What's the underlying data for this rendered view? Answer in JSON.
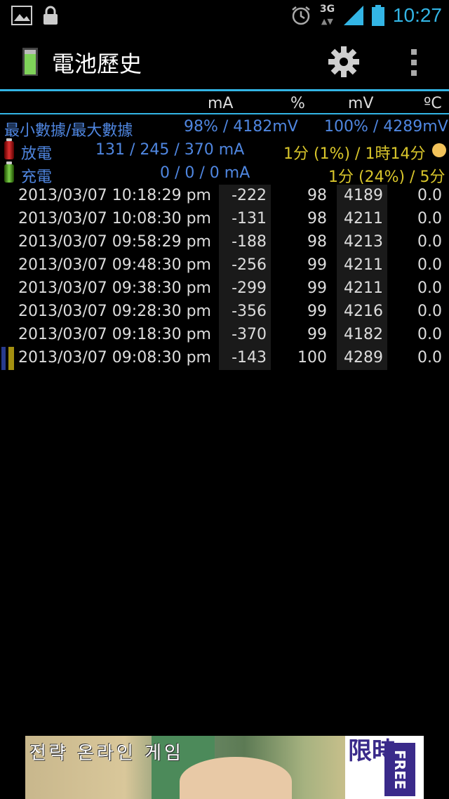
{
  "status_bar": {
    "network": "3G",
    "network_arrows": "▲▼",
    "time": "10:27"
  },
  "app": {
    "title": "電池歷史"
  },
  "columns": {
    "ma": "mA",
    "pct": "%",
    "mv": "mV",
    "temp": "ºC"
  },
  "summary": {
    "minmax_label": "最小數據/最大數據",
    "minmax_min": "98% / 4182mV",
    "minmax_max": "100% / 4289mV",
    "discharge_label": "放電",
    "discharge_ma": "131 / 245 / 370 mA",
    "discharge_time": "1分 (1%) / 1時14分",
    "charge_label": "充電",
    "charge_ma": "0 / 0 / 0 mA",
    "charge_time": "1分 (24%) / 5分"
  },
  "rows": [
    {
      "date": "2013/03/07  10:18:29 pm",
      "ma": "-222",
      "pct": "98",
      "mv": "4189",
      "temp": "0.0"
    },
    {
      "date": "2013/03/07  10:08:30 pm",
      "ma": "-131",
      "pct": "98",
      "mv": "4211",
      "temp": "0.0"
    },
    {
      "date": "2013/03/07  09:58:29 pm",
      "ma": "-188",
      "pct": "98",
      "mv": "4213",
      "temp": "0.0"
    },
    {
      "date": "2013/03/07  09:48:30 pm",
      "ma": "-256",
      "pct": "99",
      "mv": "4211",
      "temp": "0.0"
    },
    {
      "date": "2013/03/07  09:38:30 pm",
      "ma": "-299",
      "pct": "99",
      "mv": "4211",
      "temp": "0.0"
    },
    {
      "date": "2013/03/07  09:28:30 pm",
      "ma": "-356",
      "pct": "99",
      "mv": "4216",
      "temp": "0.0"
    },
    {
      "date": "2013/03/07  09:18:30 pm",
      "ma": "-370",
      "pct": "99",
      "mv": "4182",
      "temp": "0.0"
    },
    {
      "date": "2013/03/07  09:08:30 pm",
      "ma": "-143",
      "pct": "100",
      "mv": "4289",
      "temp": "0.0"
    }
  ],
  "ad": {
    "text": "전략 온라인 게임",
    "badge": "限時",
    "free": "FREE"
  },
  "colors": {
    "accent": "#33b5e5",
    "blue_text": "#4f86e0",
    "yellow_text": "#d9c62b"
  }
}
